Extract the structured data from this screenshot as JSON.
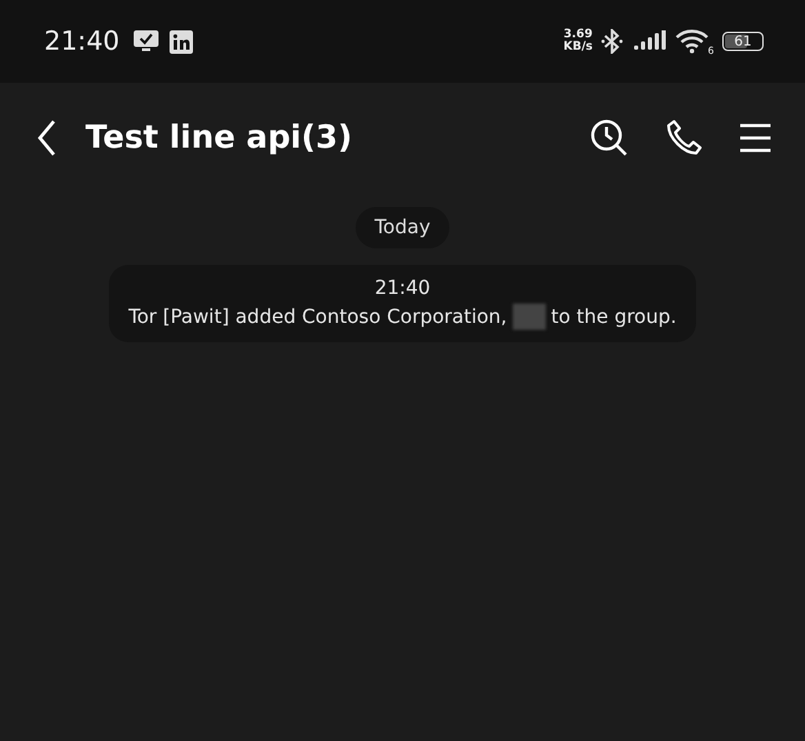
{
  "status_bar": {
    "time": "21:40",
    "speed_value": "3.69",
    "speed_unit": "KB/s",
    "wifi_label": "6",
    "battery": "61"
  },
  "header": {
    "title": "Test line api(3)"
  },
  "chat": {
    "date": "Today",
    "system_message": {
      "time": "21:40",
      "text_before": "Tor [Pawit] added Contoso Corporation,",
      "redacted": true,
      "text_after": "to the group."
    }
  }
}
